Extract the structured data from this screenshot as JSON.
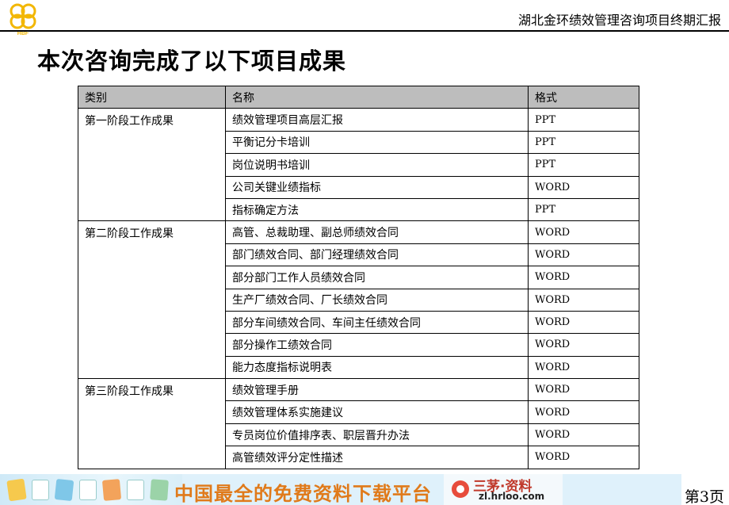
{
  "header": {
    "logo_text": "HBF",
    "title": "湖北金环绩效管理咨询项目终期汇报"
  },
  "page_title": "本次咨询完成了以下项目成果",
  "table": {
    "headers": [
      "类别",
      "名称",
      "格式"
    ],
    "rows": [
      {
        "category": "第一阶段工作成果",
        "name": "绩效管理项目高层汇报",
        "format": "PPT"
      },
      {
        "category": "",
        "name": "平衡记分卡培训",
        "format": "PPT"
      },
      {
        "category": "",
        "name": "岗位说明书培训",
        "format": "PPT"
      },
      {
        "category": "",
        "name": "公司关键业绩指标",
        "format": "WORD"
      },
      {
        "category": "",
        "name": "指标确定方法",
        "format": "PPT"
      },
      {
        "category": "第二阶段工作成果",
        "name": "高管、总裁助理、副总师绩效合同",
        "format": "WORD"
      },
      {
        "category": "",
        "name": "部门绩效合同、部门经理绩效合同",
        "format": "WORD"
      },
      {
        "category": "",
        "name": "部分部门工作人员绩效合同",
        "format": "WORD"
      },
      {
        "category": "",
        "name": "生产厂绩效合同、厂长绩效合同",
        "format": "WORD"
      },
      {
        "category": "",
        "name": "部分车间绩效合同、车间主任绩效合同",
        "format": "WORD"
      },
      {
        "category": "",
        "name": "部分操作工绩效合同",
        "format": "WORD"
      },
      {
        "category": "",
        "name": "能力态度指标说明表",
        "format": "WORD"
      },
      {
        "category": "第三阶段工作成果",
        "name": "绩效管理手册",
        "format": "WORD"
      },
      {
        "category": "",
        "name": "绩效管理体系实施建议",
        "format": "WORD"
      },
      {
        "category": "",
        "name": "专员岗位价值排序表、职层晋升办法",
        "format": "WORD"
      },
      {
        "category": "",
        "name": "高管绩效评分定性描述",
        "format": "WORD"
      }
    ]
  },
  "footer": {
    "slogan": "中国最全的免费资料下载平台",
    "brand": "三茅·资料",
    "url": "zl.hrloo.com",
    "page": "第3页"
  }
}
